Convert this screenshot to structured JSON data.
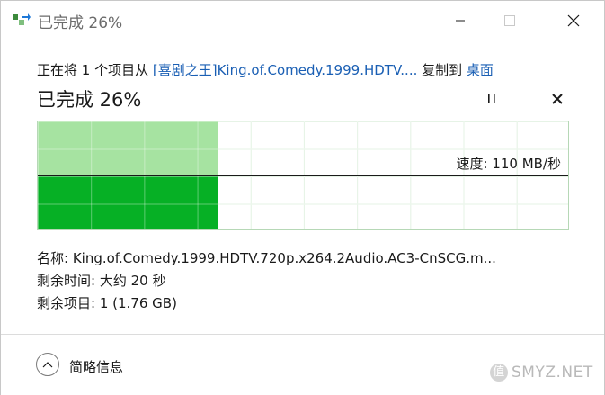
{
  "window": {
    "title": "已完成 26%"
  },
  "copy": {
    "prefix": "正在将 1 个项目从 ",
    "source": "[喜剧之王]King.of.Comedy.1999.HDTV....",
    "middle": " 复制到 ",
    "destination": "桌面"
  },
  "status": {
    "title": "已完成 26%",
    "progress_fraction": 0.34
  },
  "graph": {
    "speed_label": "速度: 110 MB/秒",
    "colors": {
      "light": "#a6e3a1",
      "dark": "#06b025"
    }
  },
  "details": {
    "name_label": "名称: ",
    "name_value": "King.of.Comedy.1999.HDTV.720p.x264.2Audio.AC3-CnSCG.m...",
    "time_label": "剩余时间: ",
    "time_value": "大约 20 秒",
    "items_label": "剩余项目: ",
    "items_value": "1 (1.76 GB)"
  },
  "footer": {
    "collapse_label": "简略信息",
    "watermark": "SMYZ.NET",
    "watermark_badge": "值"
  }
}
